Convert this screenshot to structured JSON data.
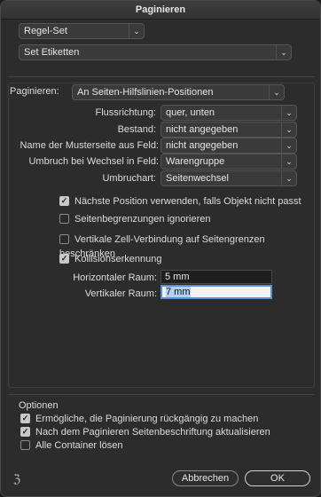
{
  "window": {
    "title": "Paginieren"
  },
  "top": {
    "ruleset_select": "Regel-Set",
    "etiketten_select": "Set Etiketten"
  },
  "paginieren": {
    "label": "Paginieren:",
    "value": "An Seiten-Hilfslinien-Positionen"
  },
  "fields": [
    {
      "label": "Flussrichtung:",
      "value": "quer, unten"
    },
    {
      "label": "Bestand:",
      "value": "nicht angegeben"
    },
    {
      "label": "Name der Musterseite aus Feld:",
      "value": "nicht angegeben"
    },
    {
      "label": "Umbruch bei Wechsel in Feld:",
      "value": "Warengruppe"
    },
    {
      "label": "Umbruchart:",
      "value": "Seitenwechsel"
    }
  ],
  "checkboxes": [
    {
      "label": "Nächste Position verwenden, falls Objekt nicht passt",
      "checked": true
    },
    {
      "label": "Seitenbegrenzungen ignorieren",
      "checked": false
    },
    {
      "label": "Vertikale Zell-Verbindung auf Seitengrenzen beschränken",
      "checked": false
    },
    {
      "label": "Kollisionserkennung",
      "checked": true
    }
  ],
  "collision": {
    "horizontal_label": "Horizontaler Raum:",
    "horizontal_value": "5 mm",
    "vertical_label": "Vertikaler Raum:",
    "vertical_value": "7 mm"
  },
  "optionen": {
    "title": "Optionen",
    "items": [
      {
        "label": "Ermögliche, die Paginierung rückgängig zu machen",
        "checked": true
      },
      {
        "label": "Nach dem Paginieren Seitenbeschriftung aktualisieren",
        "checked": true
      },
      {
        "label": "Alle Container lösen",
        "checked": false
      }
    ]
  },
  "footer": {
    "logo": "ℨ",
    "cancel_label": "Abbrechen",
    "ok_label": "OK"
  },
  "icons": {
    "dropdown": "chevron-down-icon",
    "check": "checkmark-icon"
  }
}
